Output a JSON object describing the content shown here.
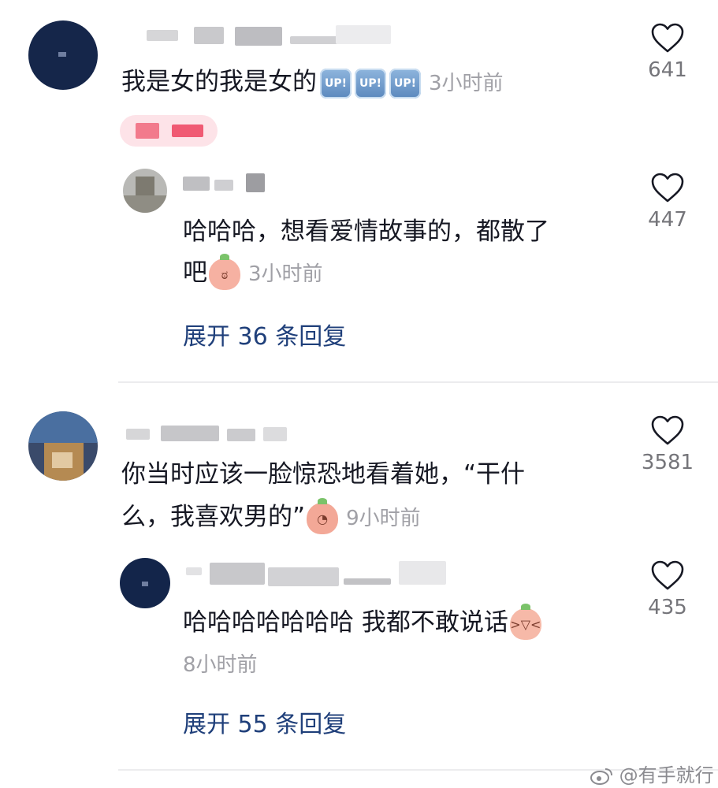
{
  "comments": [
    {
      "text": "我是女的我是女的",
      "badges": [
        "UP!",
        "UP!",
        "UP!"
      ],
      "time": "3小时前",
      "likes": "641",
      "reply": {
        "text_line1": "哈哈哈，想看爱情故事的，都散了",
        "text_line2": "吧",
        "emoji": "cover-face-emoji",
        "time": "3小时前",
        "likes": "447"
      },
      "expand": "展开 36 条回复"
    },
    {
      "text_line1": "你当时应该一脸惊恐地看着她，“干什",
      "text_line2": "么，我喜欢男的”",
      "emoji": "peeking-emoji",
      "time": "9小时前",
      "likes": "3581",
      "reply": {
        "text_line1": "哈哈哈哈哈哈哈 我都不敢说话",
        "emoji": "crying-laugh-emoji",
        "time": "8小时前",
        "likes": "435"
      },
      "expand": "展开 55 条回复"
    }
  ],
  "watermark": "@有手就行",
  "colors": {
    "text": "#161823",
    "time": "#a0a0a6",
    "expand": "#1f3f7a",
    "divider": "#ececee"
  }
}
